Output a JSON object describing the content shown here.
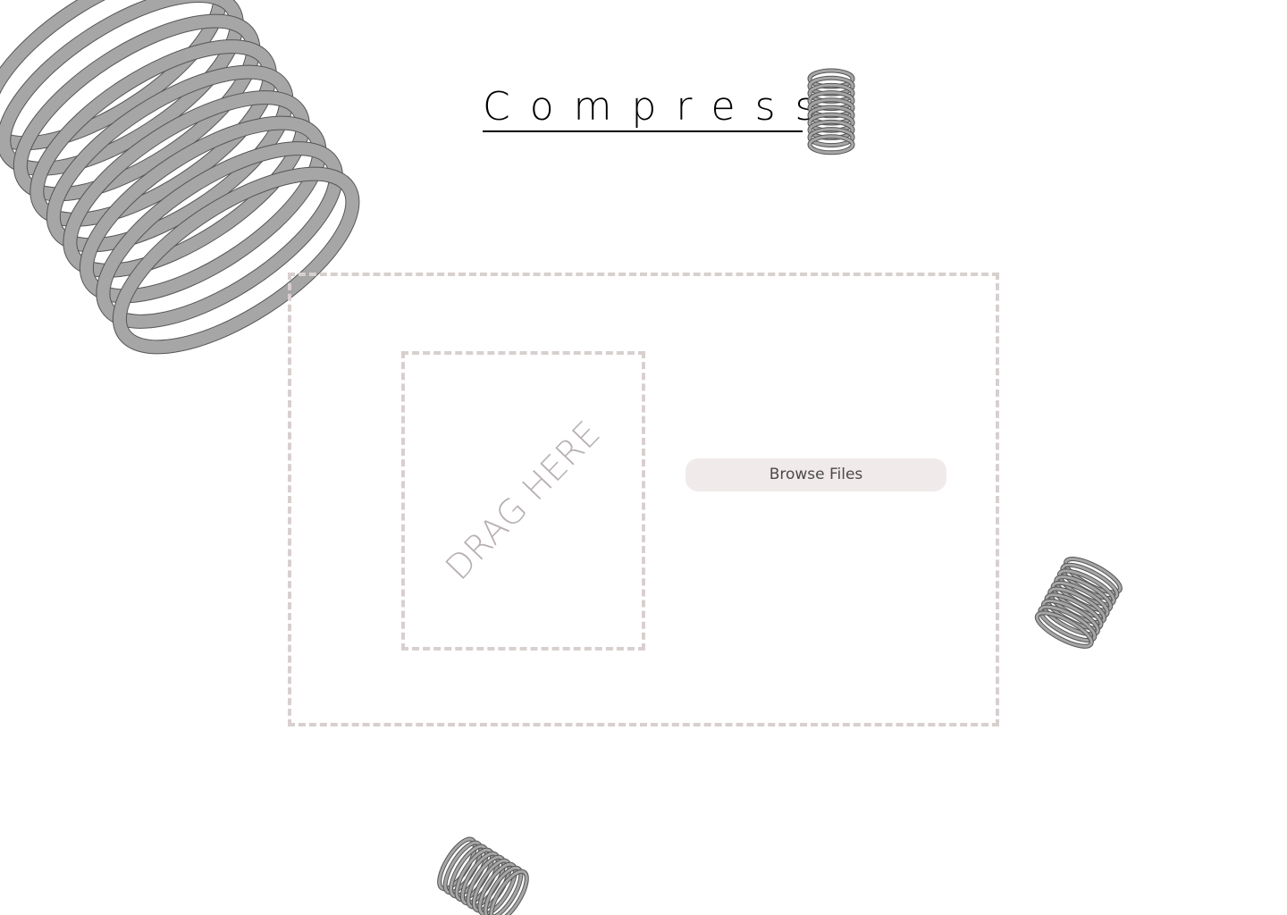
{
  "app": {
    "title": "Compress"
  },
  "dropzone": {
    "drag_label": "DRAG HERE",
    "browse_label": "Browse Files"
  },
  "colors": {
    "dash_border": "#d8cfcf",
    "button_bg": "#f1eaea",
    "spring_fill": "#a6a6a6",
    "spring_stroke": "#555555",
    "title_text": "#000000"
  },
  "icons": {
    "decorations": [
      "large-spring-icon",
      "title-spring-icon",
      "small-spring-icon",
      "bottom-spring-icon"
    ]
  }
}
